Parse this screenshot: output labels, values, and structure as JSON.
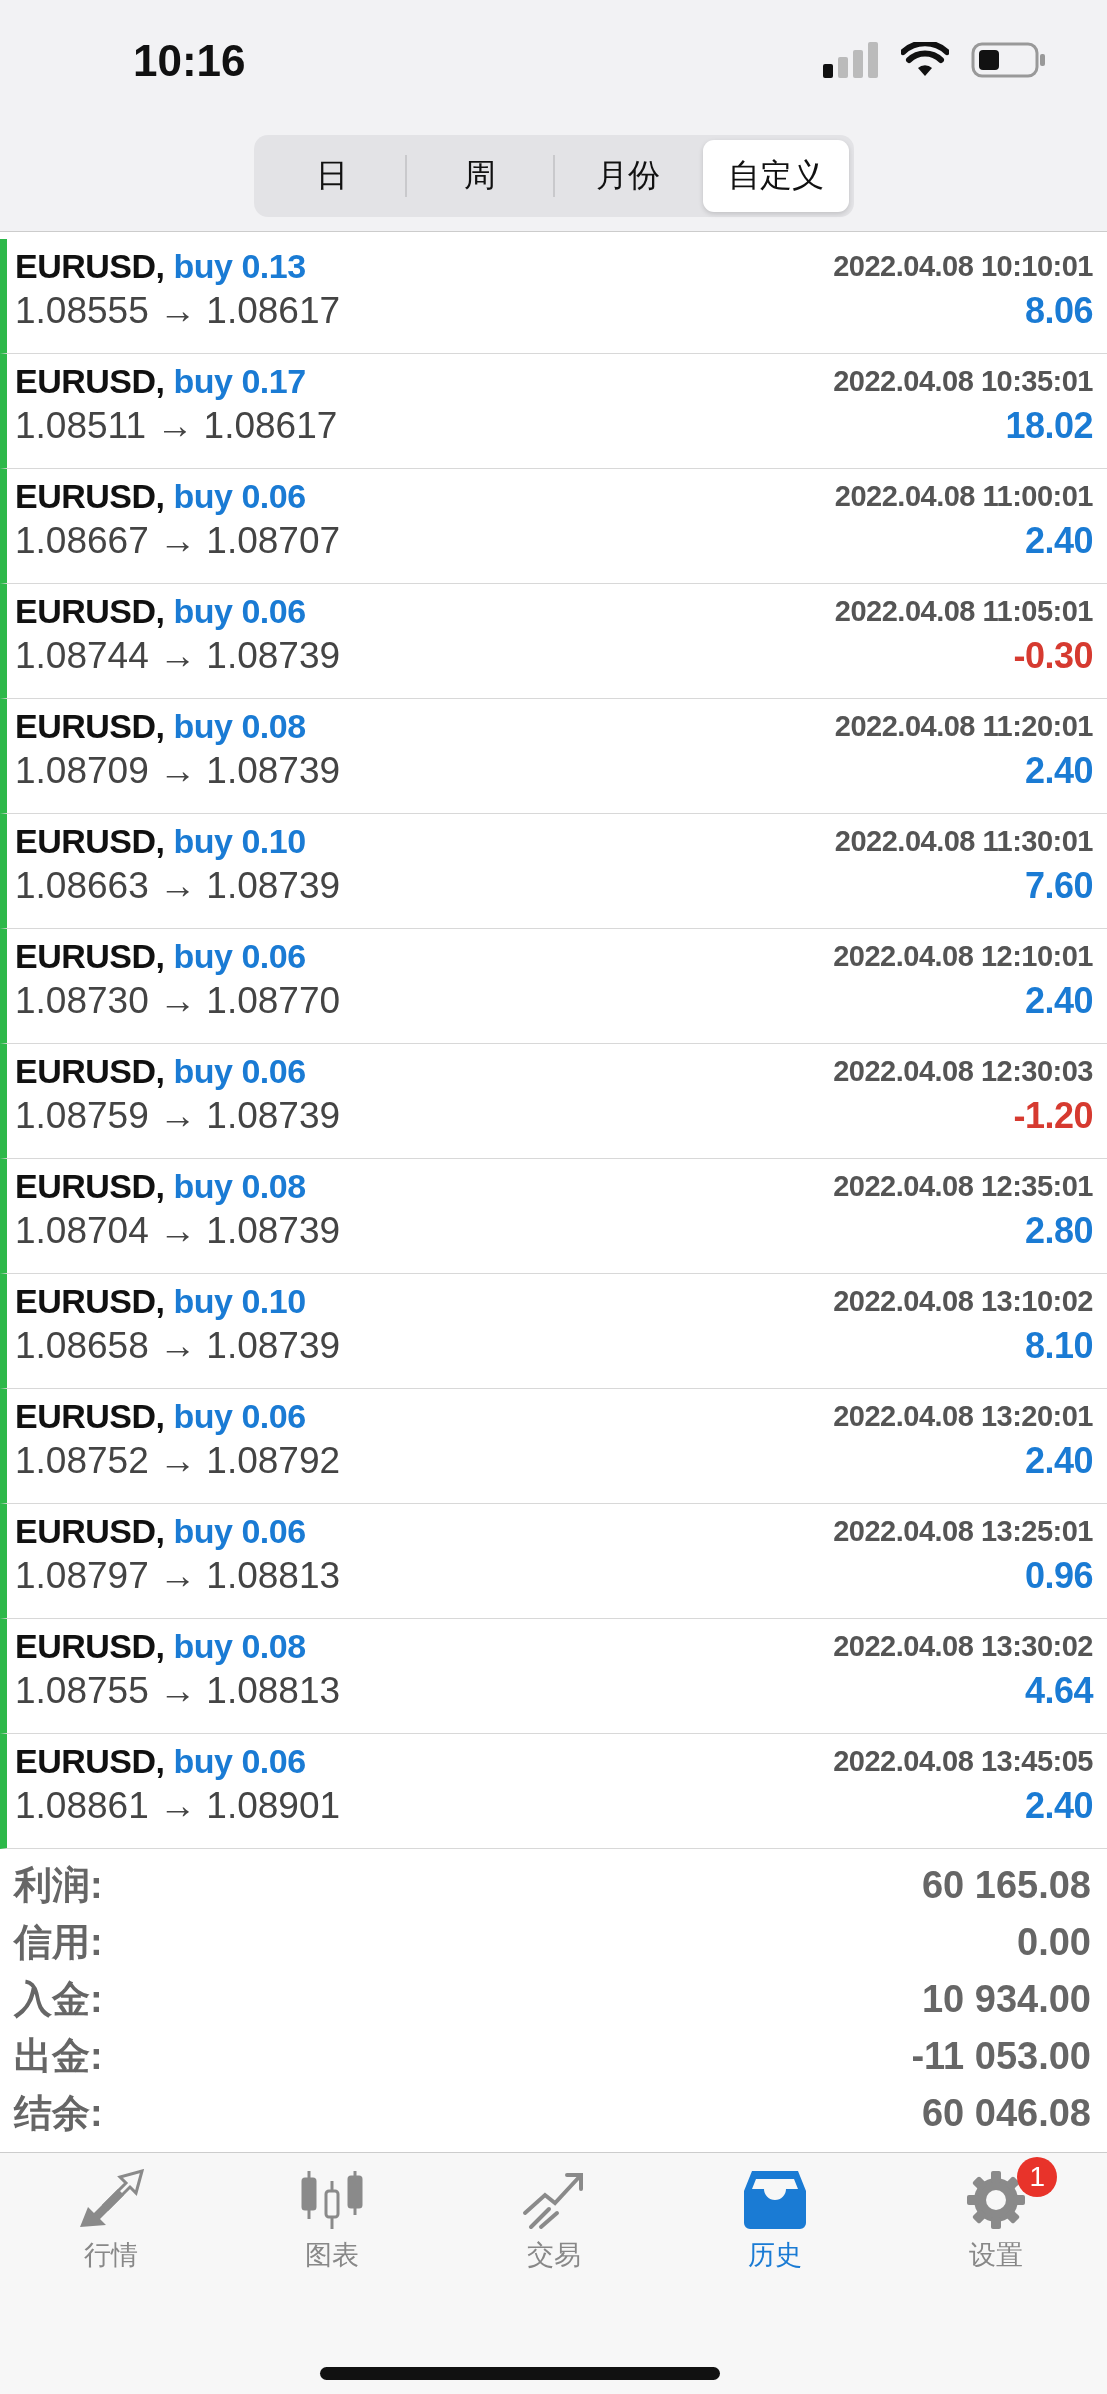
{
  "status_bar": {
    "time": "10:16"
  },
  "period_tabs": [
    {
      "label": "日",
      "selected": false
    },
    {
      "label": "周",
      "selected": false
    },
    {
      "label": "月份",
      "selected": false
    },
    {
      "label": "自定义",
      "selected": true
    }
  ],
  "trades": [
    {
      "symbol": "EURUSD,",
      "order": "buy 0.13",
      "time": "2022.04.08 10:10:01",
      "prices": "1.08555 → 1.08617",
      "profit": "8.06",
      "negative": false
    },
    {
      "symbol": "EURUSD,",
      "order": "buy 0.17",
      "time": "2022.04.08 10:35:01",
      "prices": "1.08511 → 1.08617",
      "profit": "18.02",
      "negative": false
    },
    {
      "symbol": "EURUSD,",
      "order": "buy 0.06",
      "time": "2022.04.08 11:00:01",
      "prices": "1.08667 → 1.08707",
      "profit": "2.40",
      "negative": false
    },
    {
      "symbol": "EURUSD,",
      "order": "buy 0.06",
      "time": "2022.04.08 11:05:01",
      "prices": "1.08744 → 1.08739",
      "profit": "-0.30",
      "negative": true
    },
    {
      "symbol": "EURUSD,",
      "order": "buy 0.08",
      "time": "2022.04.08 11:20:01",
      "prices": "1.08709 → 1.08739",
      "profit": "2.40",
      "negative": false
    },
    {
      "symbol": "EURUSD,",
      "order": "buy 0.10",
      "time": "2022.04.08 11:30:01",
      "prices": "1.08663 → 1.08739",
      "profit": "7.60",
      "negative": false
    },
    {
      "symbol": "EURUSD,",
      "order": "buy 0.06",
      "time": "2022.04.08 12:10:01",
      "prices": "1.08730 → 1.08770",
      "profit": "2.40",
      "negative": false
    },
    {
      "symbol": "EURUSD,",
      "order": "buy 0.06",
      "time": "2022.04.08 12:30:03",
      "prices": "1.08759 → 1.08739",
      "profit": "-1.20",
      "negative": true
    },
    {
      "symbol": "EURUSD,",
      "order": "buy 0.08",
      "time": "2022.04.08 12:35:01",
      "prices": "1.08704 → 1.08739",
      "profit": "2.80",
      "negative": false
    },
    {
      "symbol": "EURUSD,",
      "order": "buy 0.10",
      "time": "2022.04.08 13:10:02",
      "prices": "1.08658 → 1.08739",
      "profit": "8.10",
      "negative": false
    },
    {
      "symbol": "EURUSD,",
      "order": "buy 0.06",
      "time": "2022.04.08 13:20:01",
      "prices": "1.08752 → 1.08792",
      "profit": "2.40",
      "negative": false
    },
    {
      "symbol": "EURUSD,",
      "order": "buy 0.06",
      "time": "2022.04.08 13:25:01",
      "prices": "1.08797 → 1.08813",
      "profit": "0.96",
      "negative": false
    },
    {
      "symbol": "EURUSD,",
      "order": "buy 0.08",
      "time": "2022.04.08 13:30:02",
      "prices": "1.08755 → 1.08813",
      "profit": "4.64",
      "negative": false
    },
    {
      "symbol": "EURUSD,",
      "order": "buy 0.06",
      "time": "2022.04.08 13:45:05",
      "prices": "1.08861 → 1.08901",
      "profit": "2.40",
      "negative": false
    }
  ],
  "summary": [
    {
      "label": "利润:",
      "value": "60 165.08"
    },
    {
      "label": "信用:",
      "value": "0.00"
    },
    {
      "label": "入金:",
      "value": "10 934.00"
    },
    {
      "label": "出金:",
      "value": "-11 053.00"
    },
    {
      "label": "结余:",
      "value": "60 046.08"
    }
  ],
  "tab_bar": [
    {
      "kind": "quotes",
      "label": "行情",
      "selected": false
    },
    {
      "kind": "chart",
      "label": "图表",
      "selected": false
    },
    {
      "kind": "trade",
      "label": "交易",
      "selected": false
    },
    {
      "kind": "history",
      "label": "历史",
      "selected": true
    },
    {
      "kind": "settings",
      "label": "设置",
      "selected": false,
      "badge": "1"
    }
  ]
}
